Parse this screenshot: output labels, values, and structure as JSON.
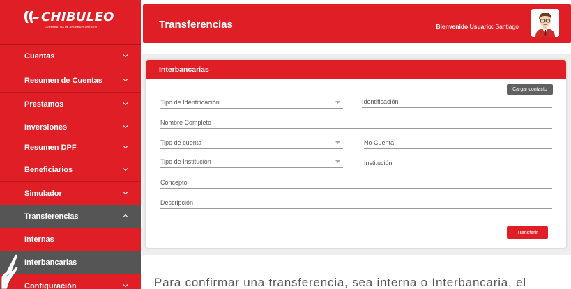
{
  "brand": {
    "name": "CHIBULEO",
    "tagline": "COOPERATIVA DE AHORRO Y CRÉDITO",
    "accent": "#e01e26"
  },
  "sidebar": {
    "items": [
      {
        "label": "Cuentas",
        "chevron": "down"
      },
      {
        "label": "Resumen de Cuentas",
        "chevron": "down"
      },
      {
        "label": "Prestamos",
        "chevron": "down"
      },
      {
        "label": "Inversiones",
        "chevron": "down"
      },
      {
        "label": "Resumen DPF",
        "chevron": "down"
      },
      {
        "label": "Beneficiarios",
        "chevron": "down"
      },
      {
        "label": "Simulador",
        "chevron": "down"
      },
      {
        "label": "Transferencias",
        "chevron": "up",
        "expanded": true
      },
      {
        "label": "Internas",
        "sub": true
      },
      {
        "label": "Interbancarias",
        "sub": true,
        "active": true
      },
      {
        "label": "Configuración",
        "chevron": "down"
      }
    ]
  },
  "header": {
    "title": "Transferencias",
    "welcome_label": "Bienvenido Usuario:",
    "welcome_user": "Santiago"
  },
  "panel": {
    "title": "Interbancarias",
    "load_contact_label": "Cargar contacto",
    "submit_label": "Transferir",
    "fields": {
      "tipo_identificacion": "Tipo de Identificación",
      "identificacion": "Identificación",
      "nombre_completo": "Nombre Completo",
      "tipo_cuenta": "Tipo de cuenta",
      "no_cuenta": "No Cuenta",
      "tipo_institucion": "Tipo de Institución",
      "institucion": "Institución",
      "concepto": "Concepto",
      "descripcion": "Descripción"
    }
  },
  "footer_text": "Para confirmar una transferencia, sea interna o Interbancaria, el"
}
